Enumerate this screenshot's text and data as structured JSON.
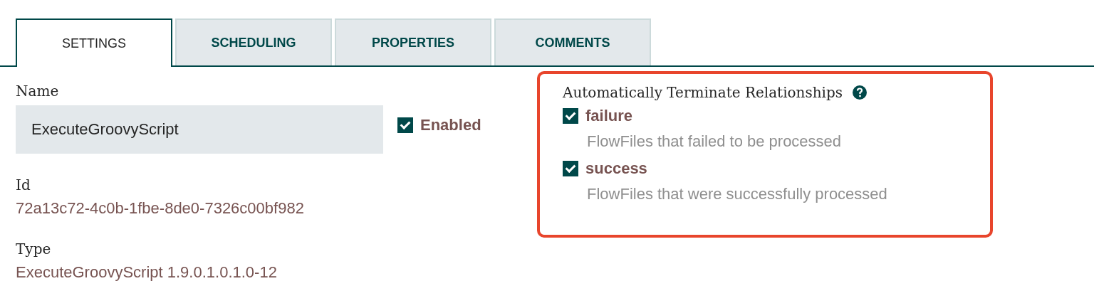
{
  "tabs": [
    {
      "label": "SETTINGS",
      "selected": true
    },
    {
      "label": "SCHEDULING",
      "selected": false
    },
    {
      "label": "PROPERTIES",
      "selected": false
    },
    {
      "label": "COMMENTS",
      "selected": false
    }
  ],
  "name": {
    "label": "Name",
    "value": "ExecuteGroovyScript"
  },
  "enabled": {
    "label": "Enabled",
    "checked": true
  },
  "id": {
    "label": "Id",
    "value": "72a13c72-4c0b-1fbe-8de0-7326c00bf982"
  },
  "type": {
    "label": "Type",
    "value": "ExecuteGroovyScript 1.9.0.1.0.1.0-12"
  },
  "relationships": {
    "title": "Automatically Terminate Relationships",
    "items": [
      {
        "name": "failure",
        "description": "FlowFiles that failed to be processed",
        "checked": true
      },
      {
        "name": "success",
        "description": "FlowFiles that were successfully processed",
        "checked": true
      }
    ]
  }
}
